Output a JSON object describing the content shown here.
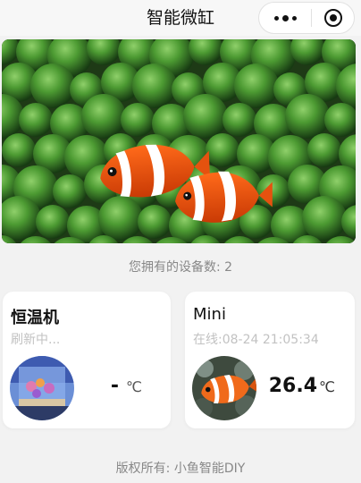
{
  "app": {
    "title": "智能微缸"
  },
  "capsule": {
    "more_icon": "ellipsis-icon",
    "close_icon": "target-icon"
  },
  "banner": {
    "subject": "clownfish-in-anemone-photo"
  },
  "devices": {
    "count_text": "您拥有的设备数: 2",
    "items": [
      {
        "name": "恒温机",
        "status": "刷新中...",
        "temperature": "-",
        "unit": "℃",
        "thumbnail": "aquarium-tank-photo"
      },
      {
        "name": "Mini",
        "status": "在线:08-24 21:05:34",
        "temperature": "26.4",
        "unit": "℃",
        "thumbnail": "clownfish-photo"
      }
    ]
  },
  "footer": {
    "copyright": "版权所有: 小鱼智能DIY"
  },
  "colors": {
    "background": "#f2f2f2",
    "card": "#ffffff",
    "muted_text": "#888888",
    "status_text": "#c2c2c2"
  }
}
